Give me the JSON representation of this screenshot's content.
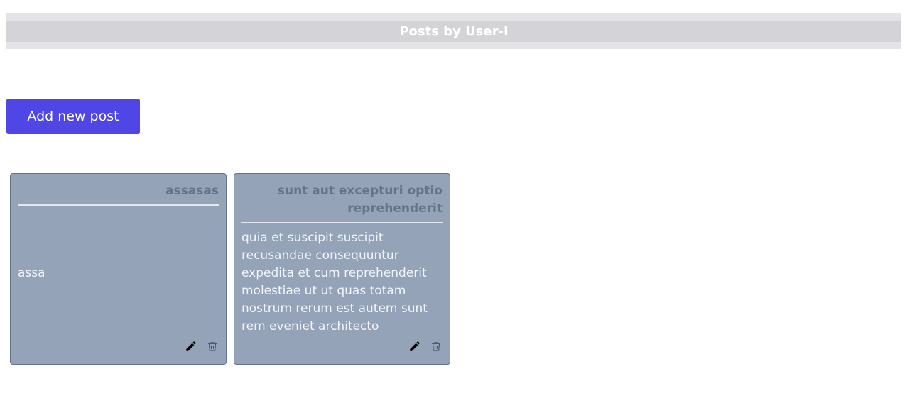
{
  "header": {
    "title": "Posts by User-I"
  },
  "toolbar": {
    "add_post_label": "Add new post"
  },
  "posts": [
    {
      "title": "assasas",
      "body": "assa"
    },
    {
      "title": "sunt aut excepturi optio reprehenderit",
      "body": "quia et suscipit suscipit recusandae consequuntur expedita et cum reprehenderit molestiae ut ut quas totam nostrum rerum est autem sunt rem eveniet architecto"
    }
  ],
  "icons": {
    "edit": "pencil-icon",
    "delete": "trash-icon"
  },
  "colors": {
    "accent": "#4f46e5",
    "card_background": "#94a3b8",
    "header_bar": "#d4d4d8"
  }
}
